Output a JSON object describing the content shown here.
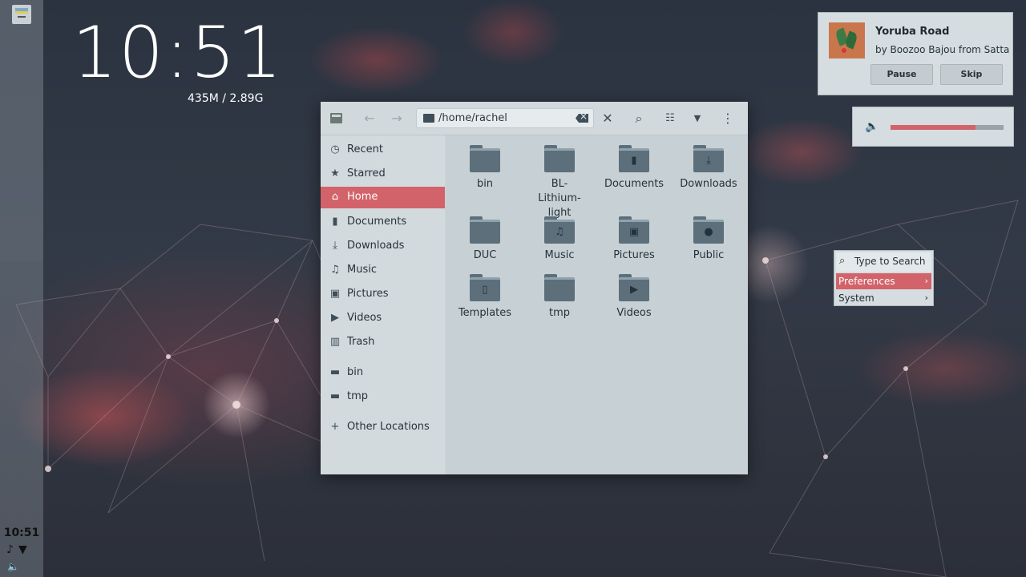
{
  "desktop": {
    "clock": "10:51",
    "memory": "435M / 2.89G"
  },
  "dock": {
    "time": "10:51",
    "tray_icons": [
      "music-note-icon",
      "wifi-icon",
      "volume-icon"
    ]
  },
  "file_manager": {
    "path": "/home/rachel",
    "sidebar": [
      {
        "label": "Recent",
        "icon": "clock-icon",
        "active": false
      },
      {
        "label": "Starred",
        "icon": "star-icon",
        "active": false
      },
      {
        "label": "Home",
        "icon": "home-icon",
        "active": true
      },
      {
        "label": "Documents",
        "icon": "document-icon",
        "active": false
      },
      {
        "label": "Downloads",
        "icon": "download-icon",
        "active": false
      },
      {
        "label": "Music",
        "icon": "music-icon",
        "active": false
      },
      {
        "label": "Pictures",
        "icon": "picture-icon",
        "active": false
      },
      {
        "label": "Videos",
        "icon": "video-icon",
        "active": false
      },
      {
        "label": "Trash",
        "icon": "trash-icon",
        "active": false
      },
      {
        "label": "bin",
        "icon": "folder-icon",
        "active": false
      },
      {
        "label": "tmp",
        "icon": "folder-icon",
        "active": false
      },
      {
        "label": "Other Locations",
        "icon": "plus-icon",
        "active": false
      }
    ],
    "files": [
      {
        "name": "bin",
        "emblem": ""
      },
      {
        "name": "BL-Lithium-light",
        "emblem": ""
      },
      {
        "name": "Documents",
        "emblem": "document-icon"
      },
      {
        "name": "Downloads",
        "emblem": "download-icon"
      },
      {
        "name": "DUC",
        "emblem": ""
      },
      {
        "name": "Music",
        "emblem": "music-icon"
      },
      {
        "name": "Pictures",
        "emblem": "picture-icon"
      },
      {
        "name": "Public",
        "emblem": "person-icon"
      },
      {
        "name": "Templates",
        "emblem": "template-icon"
      },
      {
        "name": "tmp",
        "emblem": ""
      },
      {
        "name": "Videos",
        "emblem": "video-icon"
      }
    ]
  },
  "music_player": {
    "title": "Yoruba Road",
    "artist": "by Boozoo Bajou from Satta",
    "pause_label": "Pause",
    "skip_label": "Skip"
  },
  "volume": {
    "level": 0.75
  },
  "context_menu": {
    "search_placeholder": "Type to Search",
    "items": [
      {
        "label": "Preferences",
        "arrow": "›",
        "active": true
      },
      {
        "label": "System",
        "arrow": "›",
        "active": false
      }
    ]
  },
  "colors": {
    "accent": "#d2636a",
    "panel": "#d5dde0",
    "folder": "#5c6f7b"
  }
}
